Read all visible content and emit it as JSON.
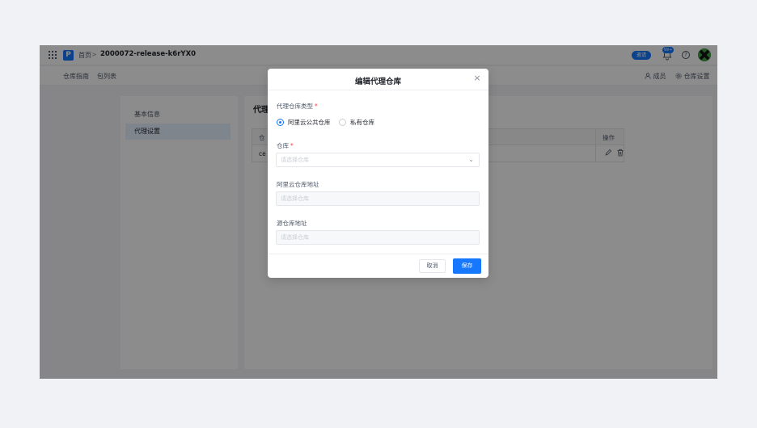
{
  "topbar": {
    "logo_letter": "P",
    "breadcrumb_home": "首页",
    "breadcrumb_sep": ">",
    "breadcrumb_current": "2000072-release-k6rYX0",
    "invite_label": "邀请",
    "notif_count": "99+",
    "help_glyph": "?"
  },
  "subnav": {
    "items": [
      "仓库指南",
      "包列表"
    ],
    "members_label": "成员",
    "settings_label": "仓库设置"
  },
  "sidebar": {
    "items": [
      {
        "label": "基本信息",
        "active": false
      },
      {
        "label": "代理设置",
        "active": true
      }
    ]
  },
  "content": {
    "title": "代理",
    "table": {
      "first_col_header": "仓",
      "op_header": "操作",
      "first_cell": "ce"
    }
  },
  "modal": {
    "title": "编辑代理仓库",
    "close_glyph": "×",
    "type_label": "代理仓库类型",
    "required_mark": "*",
    "radio_options": [
      "阿里云公共仓库",
      "私有仓库"
    ],
    "selected_option": "阿里云公共仓库",
    "repo_label": "仓库",
    "repo_placeholder": "请选择仓库",
    "aliyun_addr_label": "阿里云仓库地址",
    "aliyun_addr_placeholder": "请选择仓库",
    "source_addr_label": "源仓库地址",
    "source_addr_placeholder": "请选择仓库",
    "cancel_label": "取消",
    "save_label": "保存"
  },
  "colors": {
    "accent": "#1677ff",
    "required": "#f53f3f",
    "page_bg": "#f1f2f6"
  },
  "icons": [
    "grid-icon",
    "bell-icon",
    "help-icon",
    "user-icon",
    "gear-icon",
    "edit-icon",
    "delete-icon",
    "close-icon",
    "chevron-down-icon"
  ]
}
